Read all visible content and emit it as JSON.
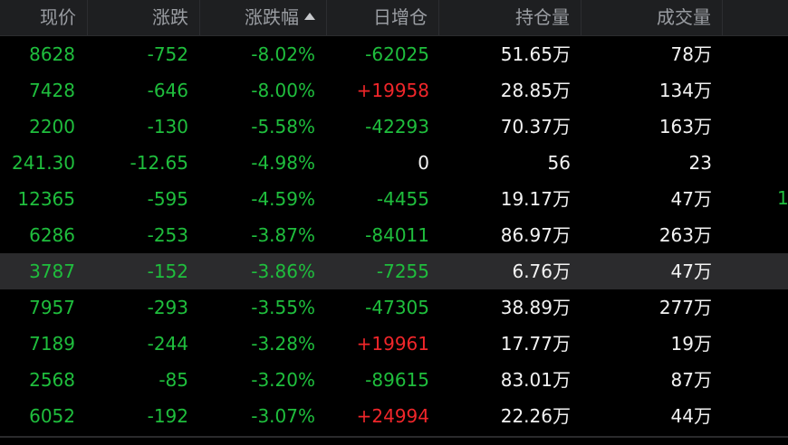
{
  "headers": {
    "price": "现价",
    "change": "涨跌",
    "change_pct": "涨跌幅",
    "daily_oi_change": "日增仓",
    "open_interest": "持仓量",
    "volume": "成交量"
  },
  "rows": [
    {
      "price": "8628",
      "change": "-752",
      "pct": "-8.02%",
      "oi_change": "-62025",
      "oi_change_color": "green",
      "oi": "51.65万",
      "volume": "78万"
    },
    {
      "price": "7428",
      "change": "-646",
      "pct": "-8.00%",
      "oi_change": "+19958",
      "oi_change_color": "red",
      "oi": "28.85万",
      "volume": "134万"
    },
    {
      "price": "2200",
      "change": "-130",
      "pct": "-5.58%",
      "oi_change": "-42293",
      "oi_change_color": "green",
      "oi": "70.37万",
      "volume": "163万"
    },
    {
      "price": "241.30",
      "change": "-12.65",
      "pct": "-4.98%",
      "oi_change": "0",
      "oi_change_color": "white",
      "oi": "56",
      "volume": "23"
    },
    {
      "price": "12365",
      "change": "-595",
      "pct": "-4.59%",
      "oi_change": "-4455",
      "oi_change_color": "green",
      "oi": "19.17万",
      "volume": "47万"
    },
    {
      "price": "6286",
      "change": "-253",
      "pct": "-3.87%",
      "oi_change": "-84011",
      "oi_change_color": "green",
      "oi": "86.97万",
      "volume": "263万"
    },
    {
      "price": "3787",
      "change": "-152",
      "pct": "-3.86%",
      "oi_change": "-7255",
      "oi_change_color": "green",
      "oi": "6.76万",
      "volume": "47万",
      "selected": true
    },
    {
      "price": "7957",
      "change": "-293",
      "pct": "-3.55%",
      "oi_change": "-47305",
      "oi_change_color": "green",
      "oi": "38.89万",
      "volume": "277万"
    },
    {
      "price": "7189",
      "change": "-244",
      "pct": "-3.28%",
      "oi_change": "+19961",
      "oi_change_color": "red",
      "oi": "17.77万",
      "volume": "19万"
    },
    {
      "price": "2568",
      "change": "-85",
      "pct": "-3.20%",
      "oi_change": "-89615",
      "oi_change_color": "green",
      "oi": "83.01万",
      "volume": "87万"
    },
    {
      "price": "6052",
      "change": "-192",
      "pct": "-3.07%",
      "oi_change": "+24994",
      "oi_change_color": "red",
      "oi": "22.26万",
      "volume": "44万"
    }
  ],
  "edge_mark": "1",
  "colors": {
    "down": "#1fbe3d",
    "up": "#f0262a",
    "neutral": "#f3f3f3",
    "header_bg": "#1e1f21",
    "selected_bg": "#2b2b2d"
  }
}
